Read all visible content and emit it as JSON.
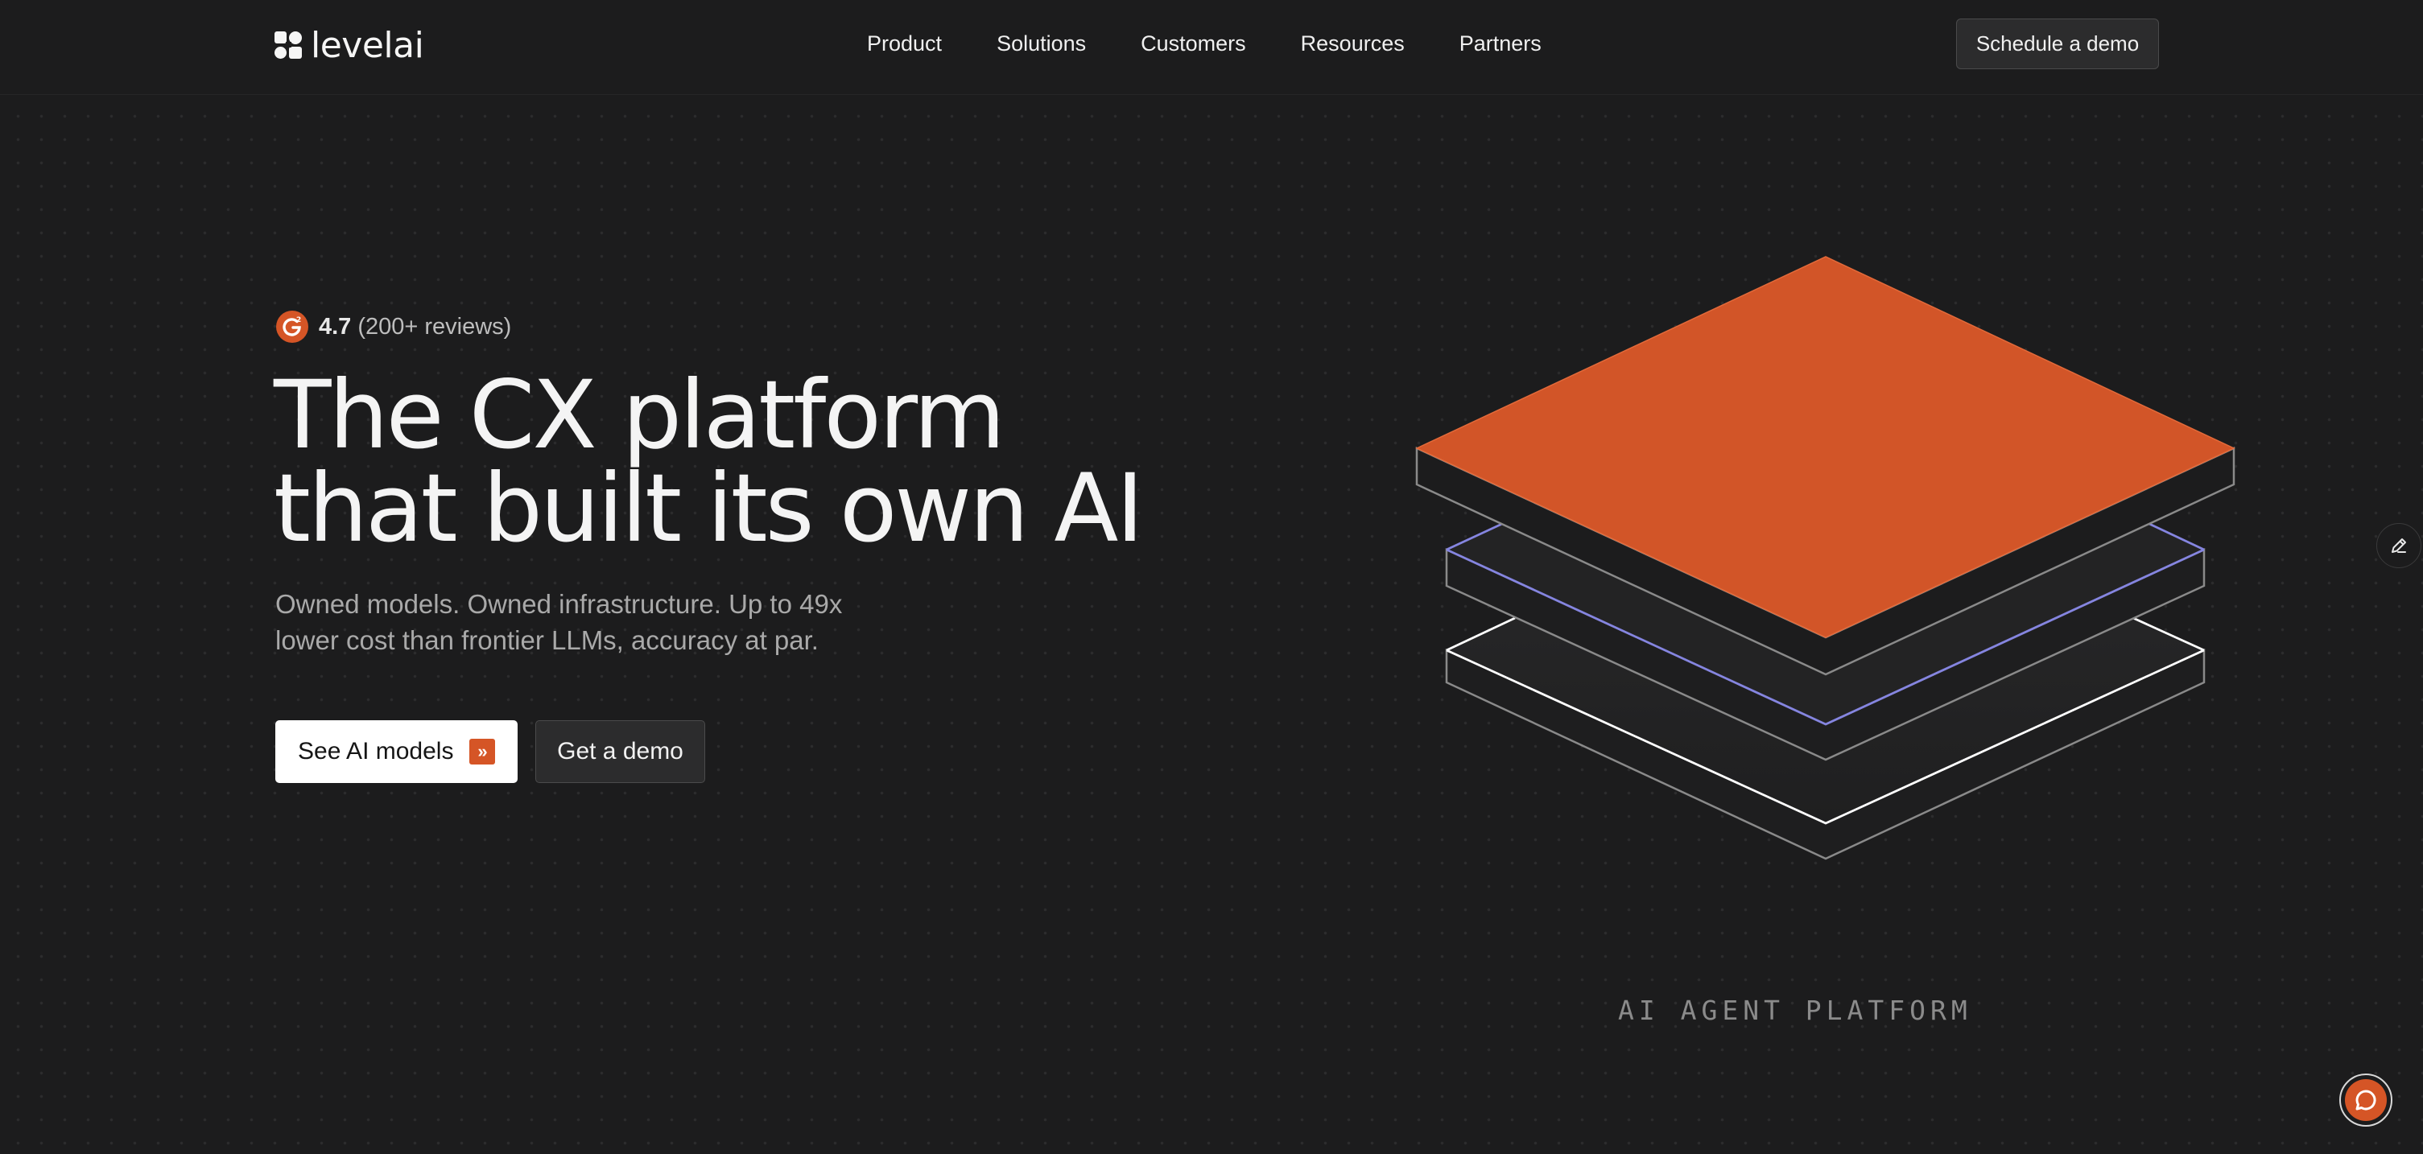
{
  "brand": {
    "name": "levelai",
    "accent_color": "#d55526",
    "logo_icon": "levelai-logo-icon"
  },
  "nav": {
    "items": [
      {
        "label": "Product"
      },
      {
        "label": "Solutions"
      },
      {
        "label": "Customers"
      },
      {
        "label": "Resources"
      },
      {
        "label": "Partners"
      }
    ],
    "cta_label": "Schedule a demo"
  },
  "hero": {
    "rating": {
      "icon": "g2-icon",
      "score": "4.7",
      "reviews": "(200+ reviews)"
    },
    "headline_line1": "The CX platform",
    "headline_line2": "that built its own AI",
    "subhead_line1": "Owned models. Owned infrastructure. Up to 49x",
    "subhead_line2": "lower cost than frontier LLMs, accuracy at par.",
    "primary_cta": {
      "label": "See AI models",
      "icon": "double-chevron-right-icon"
    },
    "secondary_cta": {
      "label": "Get a demo"
    }
  },
  "illustration": {
    "caption": "AI AGENT PLATFORM",
    "top_layer_color": "#d25528",
    "middle_outline_color": "#8585e0",
    "bottom_outline_color": "#ffffff"
  },
  "floating": {
    "edit_icon": "pencil-icon",
    "chat_icon": "chat-bubble-icon"
  }
}
